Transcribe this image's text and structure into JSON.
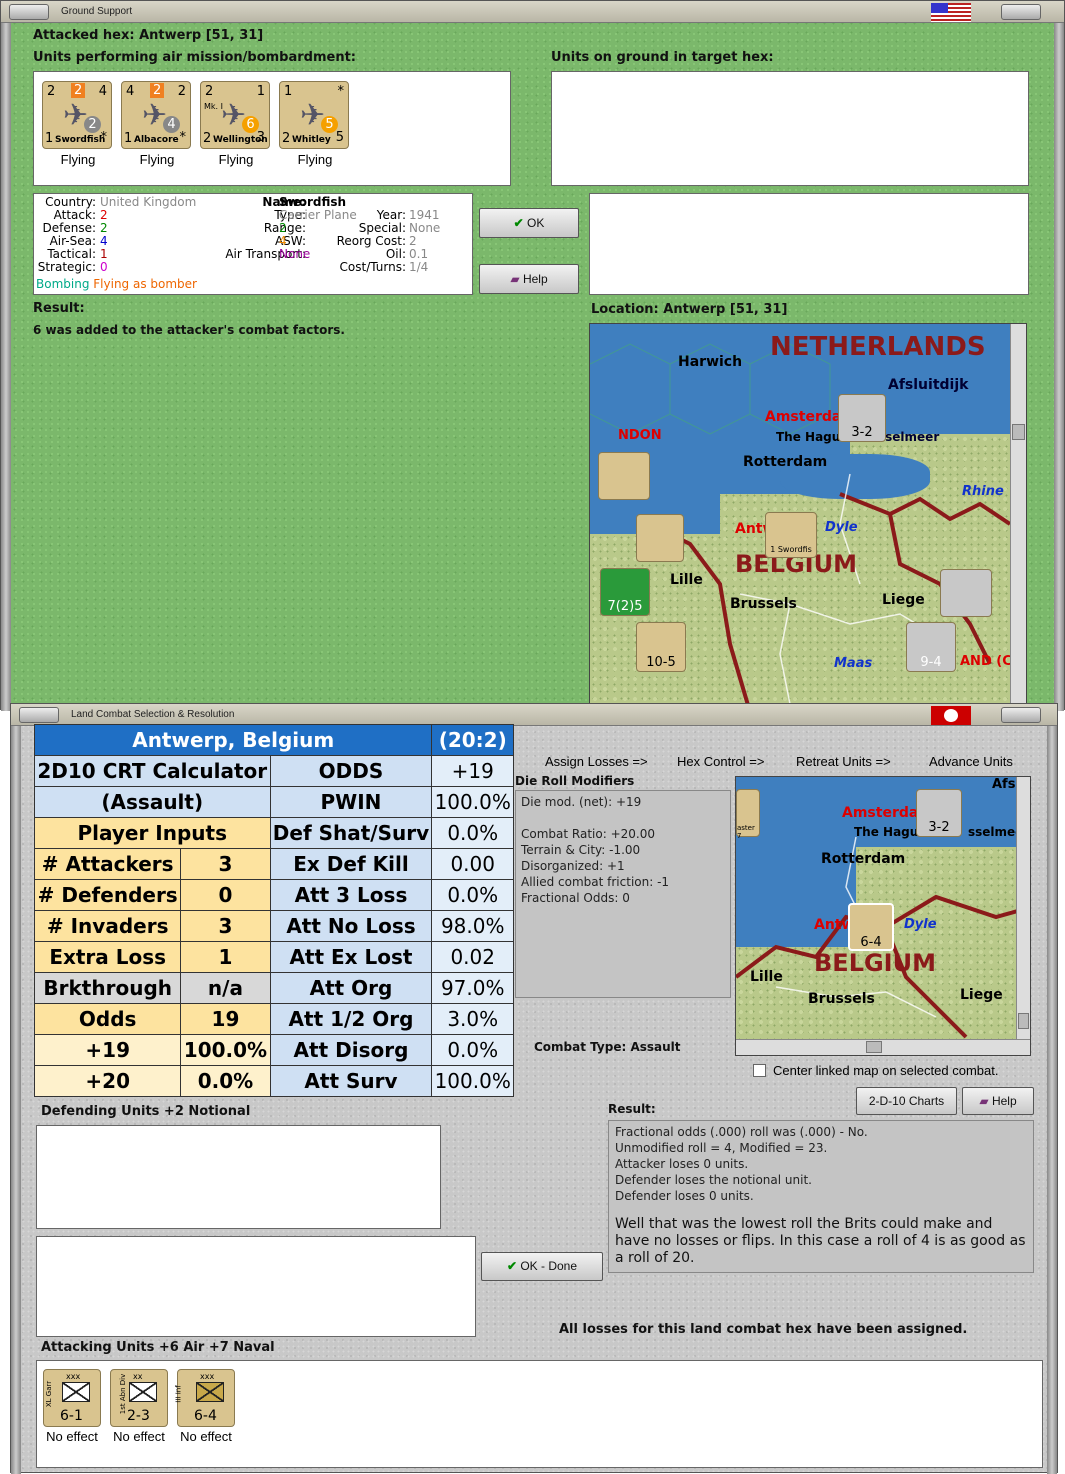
{
  "ground_support": {
    "title": "Ground Support",
    "attacked_hex": "Attacked hex: Antwerp  [51, 31]",
    "units_air_label": "Units performing air mission/bombardment:",
    "units_ground_label": "Units on ground in target hex:",
    "air_units": [
      {
        "name": "Swordfish",
        "top_left": "2",
        "top_mid": "2",
        "top_right": "4",
        "bottom_left": "1",
        "badge": "2",
        "mark": "*",
        "status": "Flying"
      },
      {
        "name": "Albacore",
        "top_left": "4",
        "top_mid": "2",
        "top_right": "2",
        "bottom_left": "1",
        "badge": "4",
        "mark": "*",
        "status": "Flying"
      },
      {
        "name": "Wellington",
        "top_left": "2",
        "top_mid": "",
        "top_right": "1",
        "bottom_left": "2",
        "badge": "6",
        "mark": "3",
        "sub": "Mk. I",
        "status": "Flying"
      },
      {
        "name": "Whitley",
        "top_left": "1",
        "top_mid": "",
        "top_right": "*",
        "bottom_left": "2",
        "badge": "5",
        "mark": "5",
        "status": "Flying"
      }
    ],
    "info": {
      "country_label": "Country:",
      "country": "United Kingdom",
      "attack_label": "Attack:",
      "attack": "2",
      "defense_label": "Defense:",
      "defense": "2",
      "airsea_label": "Air-Sea:",
      "airsea": "4",
      "tactical_label": "Tactical:",
      "tactical": "1",
      "strategic_label": "Strategic:",
      "strategic": "0",
      "bombing": "Bombing",
      "flying": "Flying as bomber",
      "name_label": "Name:",
      "name": "Swordfish",
      "type_label": "Type:",
      "type": "Carrier Plane",
      "year_label": "Year:",
      "year": "1941",
      "range_label": "Range:",
      "range": "2",
      "special_label": "Special:",
      "special": "None",
      "asw_label": "ASW:",
      "asw": "4",
      "reorg_label": "Reorg Cost:",
      "reorg": "2",
      "transport_label": "Air Transport:",
      "transport": "None",
      "oil_label": "Oil:",
      "oil": "0.1",
      "cost_label": "Cost/Turns:",
      "cost": "1/4"
    },
    "ok": "OK",
    "help": "Help",
    "result_label": "Result:",
    "result_text": "6 was added to the attacker's combat factors.",
    "location": "Location:  Antwerp  [51, 31]",
    "map_labels": {
      "netherlands": "NETHERLANDS",
      "harwich": "Harwich",
      "afsluitdijk": "Afsluitdijk",
      "amsterdam": "Amsterdam",
      "hague": "The Hague",
      "ijsselmeer": "sselmeer",
      "ndon": "NDON",
      "rotterdam": "Rotterdam",
      "rhine": "Rhine",
      "antw": "Antw",
      "dyle": "Dyle",
      "belgium": "BELGIUM",
      "lille": "Lille",
      "brussels": "Brussels",
      "liege": "Liege",
      "maas": "Maas",
      "and": "AND (C",
      "counter_xxx": "3-2",
      "counter_92": "9-4",
      "counter_105": "10-5",
      "counter_725": "7(2)5",
      "swordfish_small": "1 Swordfis"
    }
  },
  "land_combat": {
    "title": "Land Combat Selection & Resolution",
    "steps": [
      "Assign Losses =>",
      "Hex Control =>",
      "Retreat Units =>",
      "Advance Units"
    ],
    "die_mod_label": "Die Roll Modifiers",
    "die_mods": [
      "Die mod. (net): +19",
      "",
      "Combat Ratio: +20.00",
      "Terrain & City: -1.00",
      "Disorganized: +1",
      "Allied combat friction: -1",
      "Fractional Odds: 0"
    ],
    "combat_type": "Combat Type:  Assault",
    "center_map": "Center linked map on selected combat.",
    "charts_btn": "2-D-10 Charts",
    "help_btn": "Help",
    "result_label": "Result:",
    "result_lines": [
      "Fractional odds (.000) roll was (.000)  - No.",
      "Unmodified roll = 4, Modified = 23.",
      "Attacker loses 0 units.",
      "Defender loses the notional unit.",
      "Defender loses 0 units."
    ],
    "result_comment": "Well that was the lowest roll the Brits could make and have no losses or flips.  In this case a roll of 4 is as good as a roll of 20.",
    "ok_done": "OK - Done",
    "all_losses": "All losses for this land combat hex have been assigned.",
    "defending_label": "Defending Units +2 Notional",
    "attacking_label": "Attacking Units +6 Air +7 Naval",
    "attack_units": [
      {
        "unit": "XL Garr",
        "size": "xxx",
        "value": "6-1",
        "status": "No effect"
      },
      {
        "unit": "1st Abn Div",
        "size": "xx",
        "value": "2-3",
        "status": "No effect"
      },
      {
        "unit": "III Inf",
        "size": "xxx",
        "value": "6-4",
        "status": "No effect"
      }
    ],
    "map_labels": {
      "afslu": "Afslui",
      "amsterdam": "Amsterda",
      "hague": "The Hagu",
      "ijssel": "sselmee",
      "rotterdam": "Rotterdam",
      "antw": "Antw",
      "dyle": "Dyle",
      "belgium": "BELGIUM",
      "lille": "Lille",
      "brussels": "Brussels",
      "liege": "Liege",
      "c32": "3-2",
      "c64": "6-4",
      "aster": "aster 7"
    }
  },
  "crt": {
    "title": "Antwerp, Belgium",
    "title_odds": "(20:2)",
    "calc1": "2D10 CRT Calculator",
    "calc2": "(Assault)",
    "player_inputs": "Player Inputs",
    "rows_left": [
      {
        "label": "# Attackers",
        "value": "3"
      },
      {
        "label": "# Defenders",
        "value": "0"
      },
      {
        "label": "# Invaders",
        "value": "3"
      },
      {
        "label": "Extra Loss",
        "value": "1"
      },
      {
        "label": "Brkthrough",
        "value": "n/a"
      },
      {
        "label": "Odds",
        "value": "19"
      },
      {
        "label": "+19",
        "value": "100.0%"
      },
      {
        "label": "+20",
        "value": "0.0%"
      }
    ],
    "rows_right": [
      {
        "label": "ODDS",
        "value": "+19"
      },
      {
        "label": "PWIN",
        "value": "100.0%"
      },
      {
        "label": "Def Shat/Surv",
        "value": "0.0%"
      },
      {
        "label": "Ex Def Kill",
        "value": "0.00"
      },
      {
        "label": "Att 3 Loss",
        "value": "0.0%"
      },
      {
        "label": "Att No Loss",
        "value": "98.0%"
      },
      {
        "label": "Att Ex Lost",
        "value": "0.02"
      },
      {
        "label": "Att Org",
        "value": "97.0%"
      },
      {
        "label": "Att 1/2 Org",
        "value": "3.0%"
      },
      {
        "label": "Att Disorg",
        "value": "0.0%"
      },
      {
        "label": "Att Surv",
        "value": "100.0%"
      }
    ]
  }
}
